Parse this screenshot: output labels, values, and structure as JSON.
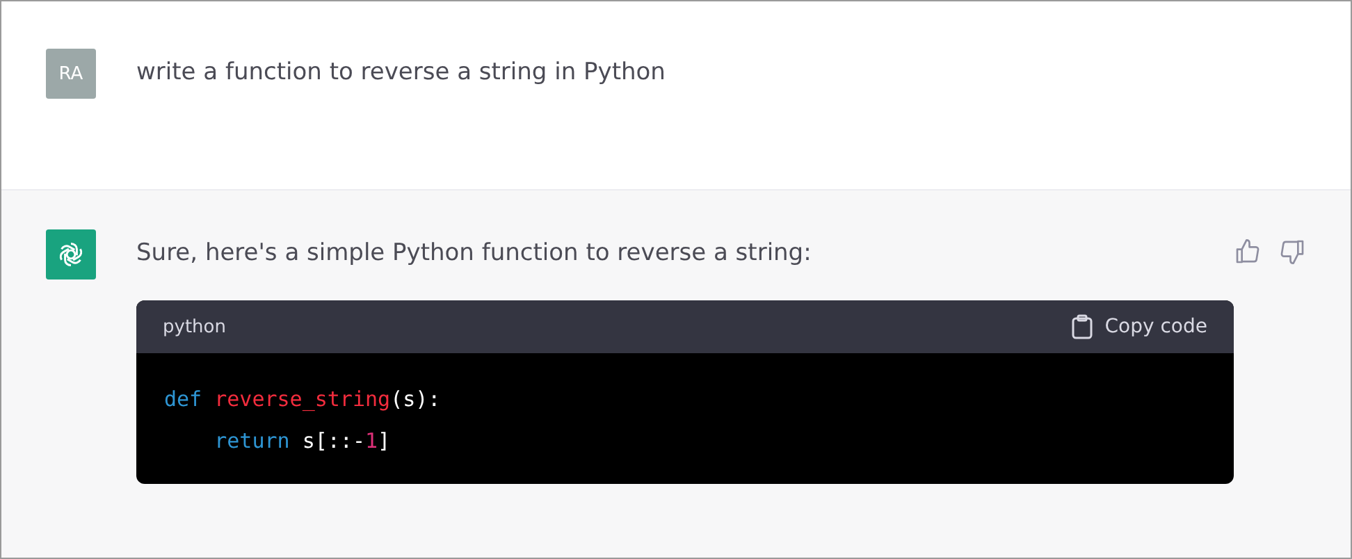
{
  "messages": [
    {
      "kind": "user",
      "avatar": "RA",
      "text": "write a function to reverse a string in Python"
    },
    {
      "kind": "assistant",
      "text": "Sure, here's a simple Python function to reverse a string:",
      "code": {
        "language": "python",
        "copy_label": "Copy code",
        "lines": [
          [
            {
              "kind": "keyword",
              "text": "def"
            },
            {
              "kind": "function",
              "text": " reverse_string"
            },
            {
              "kind": "plain",
              "text": "(s):"
            }
          ],
          [
            {
              "kind": "keyword",
              "text": "    return"
            },
            {
              "kind": "plain",
              "text": " s[::-"
            },
            {
              "kind": "number",
              "text": "1"
            },
            {
              "kind": "plain",
              "text": "]"
            }
          ]
        ]
      }
    }
  ]
}
